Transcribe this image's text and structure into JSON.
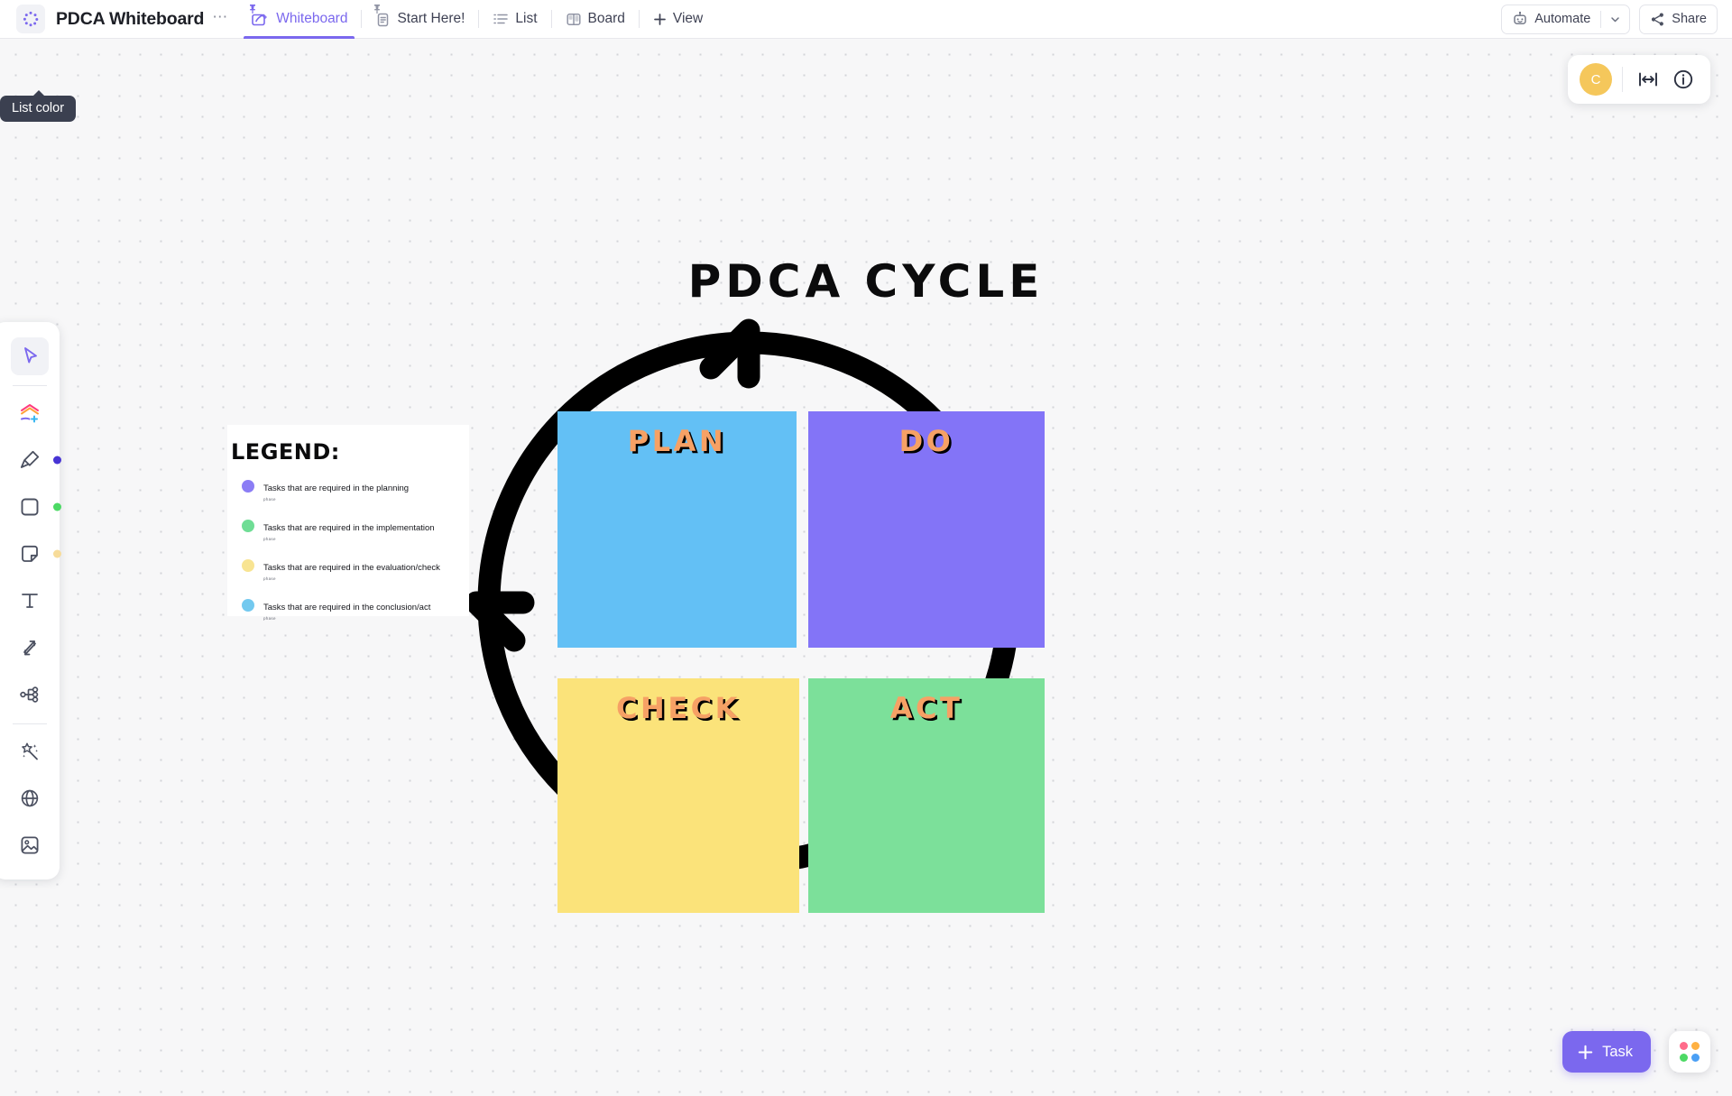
{
  "header": {
    "list_color_icon": "dotted-circle-icon",
    "board_title": "PDCA Whiteboard",
    "more_label": "⋯",
    "tabs": [
      {
        "label": "Whiteboard",
        "icon": "whiteboard-icon",
        "active": true,
        "pinned": true
      },
      {
        "label": "Start Here!",
        "icon": "doc-icon",
        "active": false,
        "pinned": true
      },
      {
        "label": "List",
        "icon": "list-icon",
        "active": false,
        "pinned": false
      },
      {
        "label": "Board",
        "icon": "board-icon",
        "active": false,
        "pinned": false
      }
    ],
    "add_view_label": "View",
    "automate_label": "Automate",
    "share_label": "Share"
  },
  "tooltip": {
    "text": "List color"
  },
  "left_toolbar": {
    "tools": [
      {
        "name": "select-tool",
        "icon": "cursor-icon",
        "selected": true
      },
      {
        "name": "add-shape-tool",
        "icon": "stacked-shapes-plus-icon",
        "selected": false
      },
      {
        "name": "pen-tool",
        "icon": "marker-pen-icon",
        "selected": false,
        "dot_color": "#4834d4"
      },
      {
        "name": "shape-tool",
        "icon": "square-icon",
        "selected": false,
        "dot_color": "#4cd964"
      },
      {
        "name": "sticky-note-tool",
        "icon": "sticky-note-icon",
        "selected": false,
        "dot_color": "#f7dc9a"
      },
      {
        "name": "text-tool",
        "icon": "text-t-icon",
        "selected": false
      },
      {
        "name": "connector-tool",
        "icon": "double-arrow-icon",
        "selected": false
      },
      {
        "name": "mindmap-tool",
        "icon": "node-tree-icon",
        "selected": false
      },
      {
        "name": "ai-tool",
        "icon": "magic-wand-icon",
        "selected": false
      },
      {
        "name": "embed-tool",
        "icon": "globe-icon",
        "selected": false
      },
      {
        "name": "image-tool",
        "icon": "image-icon",
        "selected": false
      }
    ]
  },
  "top_right_panel": {
    "avatar_initial": "C",
    "fit_icon": "fit-to-screen-icon",
    "info_icon": "info-circle-icon"
  },
  "bottom_right": {
    "task_label": "Task",
    "plus_icon": "plus-icon",
    "apps_icon": "apps-grid-icon",
    "apps_colors": [
      "#ff6b8a",
      "#ffb142",
      "#4cd964",
      "#4a9ff5"
    ]
  },
  "whiteboard": {
    "title": "PDCA CYCLE",
    "quadrants": [
      {
        "id": "plan",
        "label": "PLAN",
        "color": "#63c0f5"
      },
      {
        "id": "do",
        "label": "DO",
        "color": "#8374f7"
      },
      {
        "id": "check",
        "label": "CHECK",
        "color": "#fbe37a"
      },
      {
        "id": "act",
        "label": "ACT",
        "color": "#7ce09a"
      }
    ],
    "label_color": "#f6a165",
    "label_shadow_color": "#000000",
    "legend": {
      "heading": "LEGEND:",
      "items": [
        {
          "color": "#8b7df5",
          "text": "Tasks that are required in the planning",
          "sub": "phase"
        },
        {
          "color": "#6fdd95",
          "text": "Tasks that are required in the implementation",
          "sub": "phase"
        },
        {
          "color": "#f8e492",
          "text": "Tasks that are required in the evaluation/check",
          "sub": "phase"
        },
        {
          "color": "#73c9ef",
          "text": "Tasks that are required in the conclusion/act",
          "sub": "phase"
        }
      ]
    }
  }
}
